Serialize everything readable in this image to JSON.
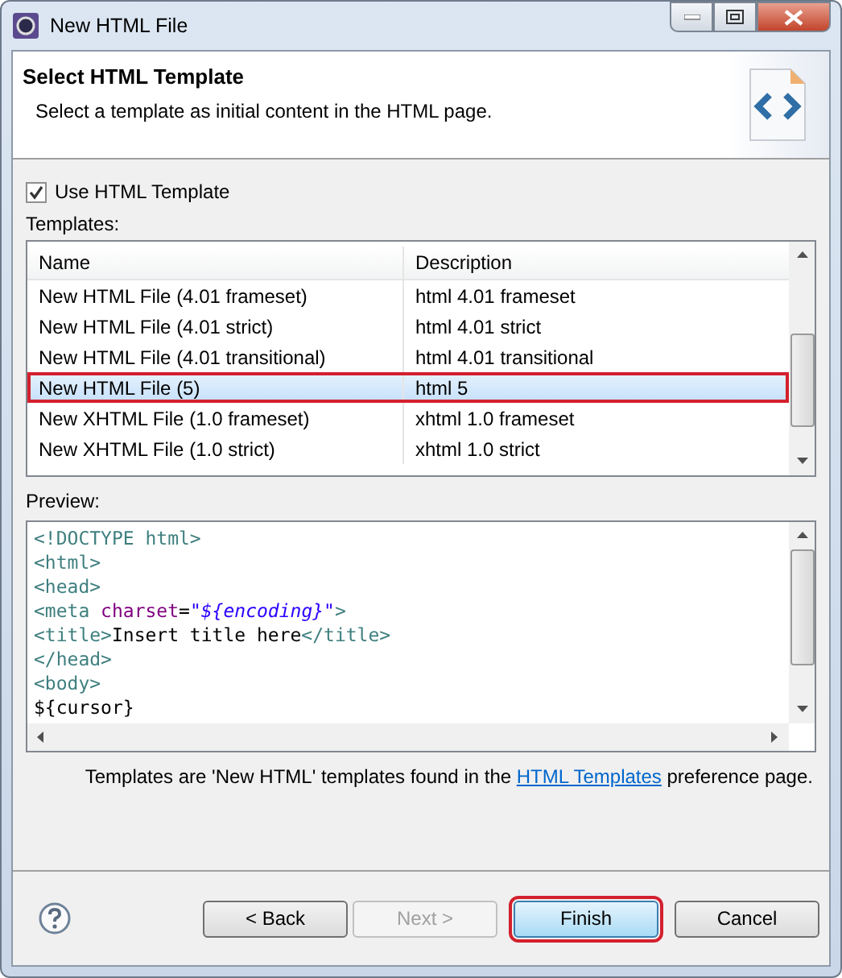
{
  "window": {
    "title": "New HTML File"
  },
  "header": {
    "title": "Select HTML Template",
    "description": "Select a template as initial content in the HTML page."
  },
  "use_template": {
    "label": "Use HTML Template",
    "checked": true
  },
  "templates": {
    "label": "Templates:",
    "columns": [
      "Name",
      "Description"
    ],
    "rows": [
      {
        "name": "New HTML File (4.01 frameset)",
        "description": "html 4.01 frameset",
        "selected": false,
        "annotated": false
      },
      {
        "name": "New HTML File (4.01 strict)",
        "description": "html 4.01 strict",
        "selected": false,
        "annotated": false
      },
      {
        "name": "New HTML File (4.01 transitional)",
        "description": "html 4.01 transitional",
        "selected": false,
        "annotated": false
      },
      {
        "name": "New HTML File (5)",
        "description": "html 5",
        "selected": true,
        "annotated": true
      },
      {
        "name": "New XHTML File (1.0 frameset)",
        "description": "xhtml 1.0 frameset",
        "selected": false,
        "annotated": false
      },
      {
        "name": "New XHTML File (1.0 strict)",
        "description": "xhtml 1.0 strict",
        "selected": false,
        "annotated": false
      }
    ]
  },
  "preview": {
    "label": "Preview:",
    "lines": [
      [
        {
          "kind": "tag",
          "text": "<!DOCTYPE html>"
        }
      ],
      [
        {
          "kind": "tag",
          "text": "<html>"
        }
      ],
      [
        {
          "kind": "tag",
          "text": "<head>"
        }
      ],
      [
        {
          "kind": "tag",
          "text": "<meta "
        },
        {
          "kind": "attr",
          "text": "charset"
        },
        {
          "kind": "text",
          "text": "="
        },
        {
          "kind": "value",
          "text": "\"${encoding}\""
        },
        {
          "kind": "tag",
          "text": ">"
        }
      ],
      [
        {
          "kind": "tag",
          "text": "<title>"
        },
        {
          "kind": "text",
          "text": "Insert title here"
        },
        {
          "kind": "tag",
          "text": "</title>"
        }
      ],
      [
        {
          "kind": "tag",
          "text": "</head>"
        }
      ],
      [
        {
          "kind": "tag",
          "text": "<body>"
        }
      ],
      [
        {
          "kind": "text",
          "text": "${cursor}"
        }
      ]
    ]
  },
  "note": {
    "before": "Templates are 'New HTML' templates found in the ",
    "link": "HTML Templates",
    "after": " preference page."
  },
  "buttons": [
    {
      "label": "< Back",
      "disabled": false,
      "default": false,
      "annotated": false
    },
    {
      "label": "Next >",
      "disabled": true,
      "default": false,
      "annotated": false
    },
    {
      "label": "Finish",
      "disabled": false,
      "default": true,
      "annotated": true
    },
    {
      "label": "Cancel",
      "disabled": false,
      "default": false,
      "annotated": false
    }
  ]
}
